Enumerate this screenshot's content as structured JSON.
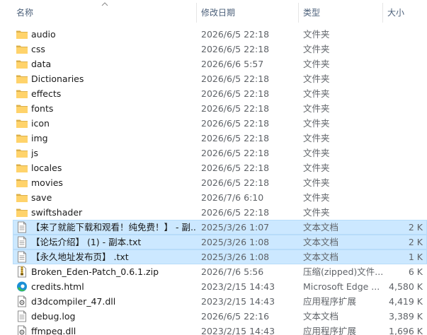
{
  "columns": {
    "name": "名称",
    "modified": "修改日期",
    "type": "类型",
    "size": "大小"
  },
  "files": [
    {
      "name": "audio",
      "modified": "2026/6/5 22:18",
      "type": "文件夹",
      "size": "",
      "icon": "folder-icon",
      "selected": false
    },
    {
      "name": "css",
      "modified": "2026/6/5 22:18",
      "type": "文件夹",
      "size": "",
      "icon": "folder-icon",
      "selected": false
    },
    {
      "name": "data",
      "modified": "2026/6/6 5:57",
      "type": "文件夹",
      "size": "",
      "icon": "folder-icon",
      "selected": false
    },
    {
      "name": "Dictionaries",
      "modified": "2026/6/5 22:18",
      "type": "文件夹",
      "size": "",
      "icon": "folder-icon",
      "selected": false
    },
    {
      "name": "effects",
      "modified": "2026/6/5 22:18",
      "type": "文件夹",
      "size": "",
      "icon": "folder-icon",
      "selected": false
    },
    {
      "name": "fonts",
      "modified": "2026/6/5 22:18",
      "type": "文件夹",
      "size": "",
      "icon": "folder-icon",
      "selected": false
    },
    {
      "name": "icon",
      "modified": "2026/6/5 22:18",
      "type": "文件夹",
      "size": "",
      "icon": "folder-icon",
      "selected": false
    },
    {
      "name": "img",
      "modified": "2026/6/5 22:18",
      "type": "文件夹",
      "size": "",
      "icon": "folder-icon",
      "selected": false
    },
    {
      "name": "js",
      "modified": "2026/6/5 22:18",
      "type": "文件夹",
      "size": "",
      "icon": "folder-icon",
      "selected": false
    },
    {
      "name": "locales",
      "modified": "2026/6/5 22:18",
      "type": "文件夹",
      "size": "",
      "icon": "folder-icon",
      "selected": false
    },
    {
      "name": "movies",
      "modified": "2026/6/5 22:18",
      "type": "文件夹",
      "size": "",
      "icon": "folder-icon",
      "selected": false
    },
    {
      "name": "save",
      "modified": "2026/7/6 6:10",
      "type": "文件夹",
      "size": "",
      "icon": "folder-icon",
      "selected": false
    },
    {
      "name": "swiftshader",
      "modified": "2026/6/5 22:18",
      "type": "文件夹",
      "size": "",
      "icon": "folder-icon",
      "selected": false
    },
    {
      "name": "【来了就能下载和观看！纯免费！】 - 副...",
      "modified": "2025/3/26 1:07",
      "type": "文本文档",
      "size": "2 K",
      "icon": "text-file-icon",
      "selected": true
    },
    {
      "name": "【论坛介绍】 (1) - 副本.txt",
      "modified": "2025/3/26 1:08",
      "type": "文本文档",
      "size": "2 K",
      "icon": "text-file-icon",
      "selected": true
    },
    {
      "name": "【永久地址发布页】 .txt",
      "modified": "2025/3/26 1:08",
      "type": "文本文档",
      "size": "1 K",
      "icon": "text-file-icon",
      "selected": true
    },
    {
      "name": "Broken_Eden-Patch_0.6.1.zip",
      "modified": "2026/7/6 5:56",
      "type": "压缩(zipped)文件...",
      "size": "6 K",
      "icon": "zip-file-icon",
      "selected": false
    },
    {
      "name": "credits.html",
      "modified": "2023/2/15 14:43",
      "type": "Microsoft Edge ...",
      "size": "4,580 K",
      "icon": "edge-html-icon",
      "selected": false
    },
    {
      "name": "d3dcompiler_47.dll",
      "modified": "2023/2/15 14:43",
      "type": "应用程序扩展",
      "size": "4,419 K",
      "icon": "dll-file-icon",
      "selected": false
    },
    {
      "name": "debug.log",
      "modified": "2026/6/5 22:16",
      "type": "文本文档",
      "size": "3,389 K",
      "icon": "text-file-icon",
      "selected": false
    },
    {
      "name": "ffmpeg.dll",
      "modified": "2023/2/15 14:43",
      "type": "应用程序扩展",
      "size": "1,696 K",
      "icon": "dll-file-icon",
      "selected": false
    }
  ]
}
